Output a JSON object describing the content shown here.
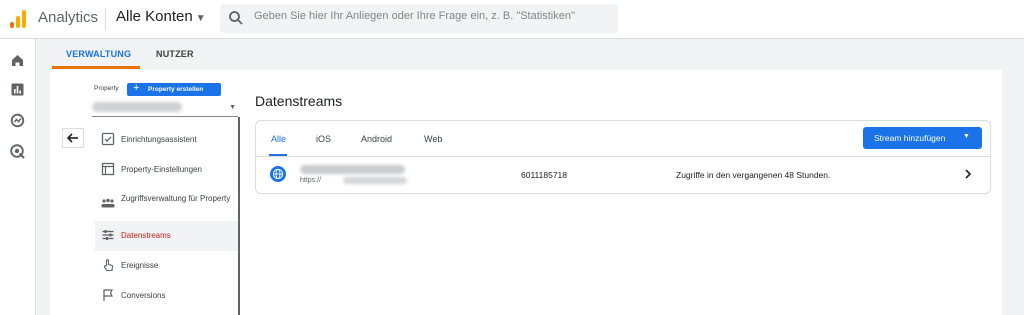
{
  "header": {
    "app_title": "Analytics",
    "account": "Alle Konten",
    "search_placeholder": "Geben Sie hier Ihr Anliegen oder Ihre Frage ein, z. B. \"Statistiken\""
  },
  "rail": {
    "icons": [
      "home-icon",
      "reports-icon",
      "explore-icon",
      "advertising-icon"
    ]
  },
  "admin_tabs": {
    "verwaltung": "VERWALTUNG",
    "nutzer": "NUTZER",
    "active": "VERWALTUNG"
  },
  "property": {
    "label": "Property",
    "create_button": "Property erstellen"
  },
  "menu": {
    "items": [
      {
        "label": "Einrichtungsassistent",
        "icon": "checklist-icon"
      },
      {
        "label": "Property-Einstellungen",
        "icon": "settings-page-icon"
      },
      {
        "label": "Zugriffsverwaltung für Property",
        "icon": "people-icon"
      },
      {
        "label": "Datenstreams",
        "icon": "streams-icon",
        "active": true
      },
      {
        "label": "Ereignisse",
        "icon": "touch-icon"
      },
      {
        "label": "Conversions",
        "icon": "flag-icon"
      }
    ]
  },
  "content": {
    "title": "Datenstreams",
    "tabs": [
      "Alle",
      "iOS",
      "Android",
      "Web"
    ],
    "active_tab": "Alle",
    "add_button": "Stream hinzufügen",
    "stream": {
      "url_prefix": "https://",
      "stream_id": "6011185718",
      "status": "Zugriffe in den vergangenen 48 Stunden."
    }
  },
  "colors": {
    "accent": "#1a73e8",
    "orange": "#e37400",
    "active_red": "#c5221f"
  }
}
